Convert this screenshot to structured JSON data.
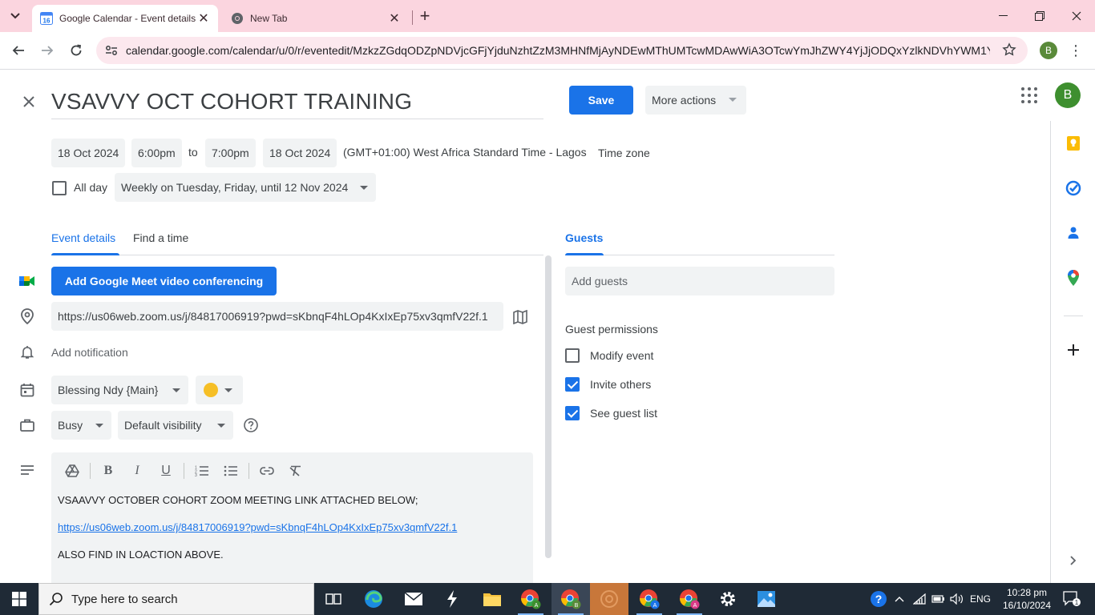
{
  "browser": {
    "tabs": [
      {
        "title": "Google Calendar - Event details",
        "favicon": "calendar-favicon",
        "favicon_text": "16"
      },
      {
        "title": "New Tab",
        "favicon": "chrome-favicon"
      }
    ],
    "url": "calendar.google.com/calendar/u/0/r/eventedit/MzkzZGdqODZpNDVjcGFjYjduNzhtZzM3MHNfMjAyNDEwMThUMTcwMDAwWiA3OTcwYmJhZWY4YjJjODQxYzlkNDVhYWM1Y...",
    "profile_initial": "B"
  },
  "event": {
    "title": "VSAVVY OCT COHORT TRAINING",
    "save_label": "Save",
    "more_actions_label": "More actions",
    "avatar_initial": "B",
    "start_date": "18 Oct 2024",
    "start_time": "6:00pm",
    "to_label": "to",
    "end_time": "7:00pm",
    "end_date": "18 Oct 2024",
    "timezone": "(GMT+01:00) West Africa Standard Time - Lagos",
    "timezone_link": "Time zone",
    "all_day_label": "All day",
    "recurrence": "Weekly on Tuesday, Friday, until 12 Nov 2024"
  },
  "tabs": {
    "event_details": "Event details",
    "find_a_time": "Find a time",
    "guests": "Guests"
  },
  "details": {
    "meet_button": "Add Google Meet video conferencing",
    "location": "https://us06web.zoom.us/j/84817006919?pwd=sKbnqF4hLOp4KxIxEp75xv3qmfV22f.1",
    "add_notification": "Add notification",
    "calendar_name": "Blessing Ndy {Main}",
    "event_color": "#f6bf26",
    "availability": "Busy",
    "visibility": "Default visibility",
    "description_lines": [
      "VSAAVVY OCTOBER COHORT ZOOM MEETING LINK ATTACHED BELOW;",
      "https://us06web.zoom.us/j/84817006919?pwd=sKbnqF4hLOp4KxIxEp75xv3qmfV22f.1",
      "ALSO FIND IN LOACTION ABOVE."
    ]
  },
  "guests": {
    "placeholder": "Add guests",
    "permissions_title": "Guest permissions",
    "permissions": [
      {
        "label": "Modify event",
        "checked": false
      },
      {
        "label": "Invite others",
        "checked": true
      },
      {
        "label": "See guest list",
        "checked": true
      }
    ]
  },
  "side_panel": {
    "icons": [
      "keep-icon",
      "tasks-icon",
      "contacts-icon",
      "maps-icon",
      "add-icon",
      "expand-icon"
    ]
  },
  "taskbar": {
    "search_placeholder": "Type here to search",
    "language": "ENG",
    "time": "10:28 pm",
    "date": "16/10/2024",
    "notification_count": "1"
  },
  "colors": {
    "primary": "#1a73e8",
    "chip_bg": "#f1f3f4",
    "tabstrip": "#fbd5df",
    "avatar": "#3e8f2f"
  }
}
